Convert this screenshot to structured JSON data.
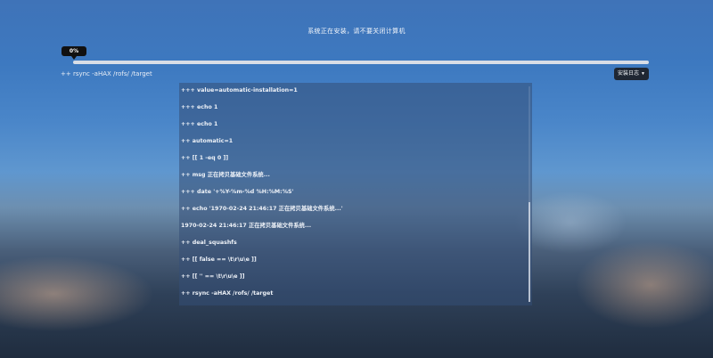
{
  "installer": {
    "title": "系统正在安装，请不要关闭计算机",
    "progress": {
      "label": "0%",
      "fraction": 0.0
    },
    "current_command": "++ rsync -aHAX /rofs/ /target",
    "log_button": {
      "label": "安装日志",
      "icon": "chevron-down-icon"
    },
    "log_lines": [
      "+++ value=automatic-installation=1",
      "+++ echo 1",
      "+++ echo 1",
      "++ automatic=1",
      "++ [[ 1 -eq 0 ]]",
      "++ msg 正在拷贝基础文件系统...",
      "+++ date '+%Y-%m-%d %H:%M:%S'",
      "++ echo '1970-02-24 21:46:17 正在拷贝基础文件系统...'",
      "1970-02-24 21:46:17 正在拷贝基础文件系统...",
      "++ deal_squashfs",
      "++ [[ false == \\t\\r\\u\\e ]]",
      "++ [[ '' == \\t\\r\\u\\e ]]",
      "++ rsync -aHAX /rofs/ /target"
    ]
  }
}
